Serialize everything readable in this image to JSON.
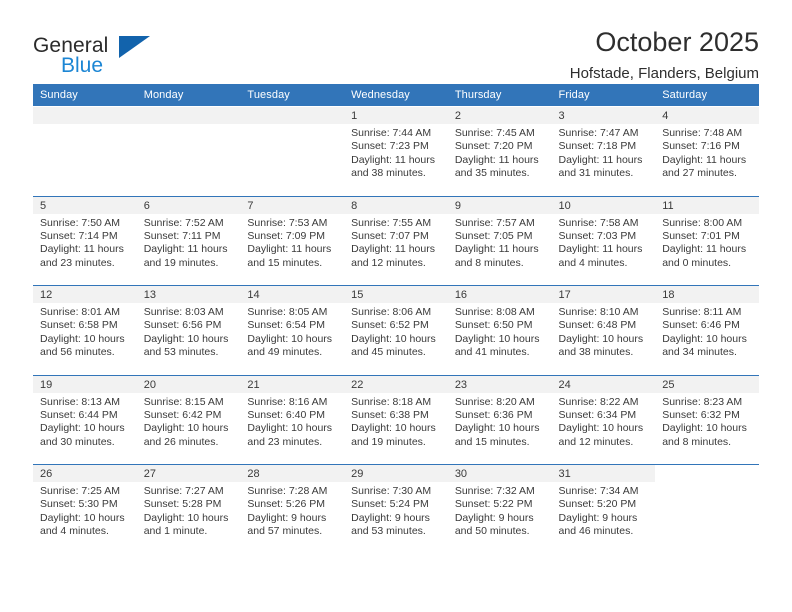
{
  "brand": {
    "line1": "General",
    "line2": "Blue",
    "logo_icon": "triangle-logo"
  },
  "header": {
    "title": "October 2025",
    "subtitle": "Hofstade, Flanders, Belgium"
  },
  "colors": {
    "header_blue": "#3275b9",
    "brand_blue": "#1c86d4",
    "logo_triangle": "#1263ac",
    "daynum_band": "#f2f2f2",
    "text": "#3a3a3a"
  },
  "weekday_headers": [
    "Sunday",
    "Monday",
    "Tuesday",
    "Wednesday",
    "Thursday",
    "Friday",
    "Saturday"
  ],
  "labels": {
    "sunrise_prefix": "Sunrise:",
    "sunset_prefix": "Sunset:",
    "daylight_prefix": "Daylight:"
  },
  "weeks": [
    [
      {
        "day": "",
        "empty": true
      },
      {
        "day": "",
        "empty": true
      },
      {
        "day": "",
        "empty": true
      },
      {
        "day": "1",
        "sunrise": "Sunrise: 7:44 AM",
        "sunset": "Sunset: 7:23 PM",
        "daylight": "Daylight: 11 hours and 38 minutes."
      },
      {
        "day": "2",
        "sunrise": "Sunrise: 7:45 AM",
        "sunset": "Sunset: 7:20 PM",
        "daylight": "Daylight: 11 hours and 35 minutes."
      },
      {
        "day": "3",
        "sunrise": "Sunrise: 7:47 AM",
        "sunset": "Sunset: 7:18 PM",
        "daylight": "Daylight: 11 hours and 31 minutes."
      },
      {
        "day": "4",
        "sunrise": "Sunrise: 7:48 AM",
        "sunset": "Sunset: 7:16 PM",
        "daylight": "Daylight: 11 hours and 27 minutes."
      }
    ],
    [
      {
        "day": "5",
        "sunrise": "Sunrise: 7:50 AM",
        "sunset": "Sunset: 7:14 PM",
        "daylight": "Daylight: 11 hours and 23 minutes."
      },
      {
        "day": "6",
        "sunrise": "Sunrise: 7:52 AM",
        "sunset": "Sunset: 7:11 PM",
        "daylight": "Daylight: 11 hours and 19 minutes."
      },
      {
        "day": "7",
        "sunrise": "Sunrise: 7:53 AM",
        "sunset": "Sunset: 7:09 PM",
        "daylight": "Daylight: 11 hours and 15 minutes."
      },
      {
        "day": "8",
        "sunrise": "Sunrise: 7:55 AM",
        "sunset": "Sunset: 7:07 PM",
        "daylight": "Daylight: 11 hours and 12 minutes."
      },
      {
        "day": "9",
        "sunrise": "Sunrise: 7:57 AM",
        "sunset": "Sunset: 7:05 PM",
        "daylight": "Daylight: 11 hours and 8 minutes."
      },
      {
        "day": "10",
        "sunrise": "Sunrise: 7:58 AM",
        "sunset": "Sunset: 7:03 PM",
        "daylight": "Daylight: 11 hours and 4 minutes."
      },
      {
        "day": "11",
        "sunrise": "Sunrise: 8:00 AM",
        "sunset": "Sunset: 7:01 PM",
        "daylight": "Daylight: 11 hours and 0 minutes."
      }
    ],
    [
      {
        "day": "12",
        "sunrise": "Sunrise: 8:01 AM",
        "sunset": "Sunset: 6:58 PM",
        "daylight": "Daylight: 10 hours and 56 minutes."
      },
      {
        "day": "13",
        "sunrise": "Sunrise: 8:03 AM",
        "sunset": "Sunset: 6:56 PM",
        "daylight": "Daylight: 10 hours and 53 minutes."
      },
      {
        "day": "14",
        "sunrise": "Sunrise: 8:05 AM",
        "sunset": "Sunset: 6:54 PM",
        "daylight": "Daylight: 10 hours and 49 minutes."
      },
      {
        "day": "15",
        "sunrise": "Sunrise: 8:06 AM",
        "sunset": "Sunset: 6:52 PM",
        "daylight": "Daylight: 10 hours and 45 minutes."
      },
      {
        "day": "16",
        "sunrise": "Sunrise: 8:08 AM",
        "sunset": "Sunset: 6:50 PM",
        "daylight": "Daylight: 10 hours and 41 minutes."
      },
      {
        "day": "17",
        "sunrise": "Sunrise: 8:10 AM",
        "sunset": "Sunset: 6:48 PM",
        "daylight": "Daylight: 10 hours and 38 minutes."
      },
      {
        "day": "18",
        "sunrise": "Sunrise: 8:11 AM",
        "sunset": "Sunset: 6:46 PM",
        "daylight": "Daylight: 10 hours and 34 minutes."
      }
    ],
    [
      {
        "day": "19",
        "sunrise": "Sunrise: 8:13 AM",
        "sunset": "Sunset: 6:44 PM",
        "daylight": "Daylight: 10 hours and 30 minutes."
      },
      {
        "day": "20",
        "sunrise": "Sunrise: 8:15 AM",
        "sunset": "Sunset: 6:42 PM",
        "daylight": "Daylight: 10 hours and 26 minutes."
      },
      {
        "day": "21",
        "sunrise": "Sunrise: 8:16 AM",
        "sunset": "Sunset: 6:40 PM",
        "daylight": "Daylight: 10 hours and 23 minutes."
      },
      {
        "day": "22",
        "sunrise": "Sunrise: 8:18 AM",
        "sunset": "Sunset: 6:38 PM",
        "daylight": "Daylight: 10 hours and 19 minutes."
      },
      {
        "day": "23",
        "sunrise": "Sunrise: 8:20 AM",
        "sunset": "Sunset: 6:36 PM",
        "daylight": "Daylight: 10 hours and 15 minutes."
      },
      {
        "day": "24",
        "sunrise": "Sunrise: 8:22 AM",
        "sunset": "Sunset: 6:34 PM",
        "daylight": "Daylight: 10 hours and 12 minutes."
      },
      {
        "day": "25",
        "sunrise": "Sunrise: 8:23 AM",
        "sunset": "Sunset: 6:32 PM",
        "daylight": "Daylight: 10 hours and 8 minutes."
      }
    ],
    [
      {
        "day": "26",
        "sunrise": "Sunrise: 7:25 AM",
        "sunset": "Sunset: 5:30 PM",
        "daylight": "Daylight: 10 hours and 4 minutes."
      },
      {
        "day": "27",
        "sunrise": "Sunrise: 7:27 AM",
        "sunset": "Sunset: 5:28 PM",
        "daylight": "Daylight: 10 hours and 1 minute."
      },
      {
        "day": "28",
        "sunrise": "Sunrise: 7:28 AM",
        "sunset": "Sunset: 5:26 PM",
        "daylight": "Daylight: 9 hours and 57 minutes."
      },
      {
        "day": "29",
        "sunrise": "Sunrise: 7:30 AM",
        "sunset": "Sunset: 5:24 PM",
        "daylight": "Daylight: 9 hours and 53 minutes."
      },
      {
        "day": "30",
        "sunrise": "Sunrise: 7:32 AM",
        "sunset": "Sunset: 5:22 PM",
        "daylight": "Daylight: 9 hours and 50 minutes."
      },
      {
        "day": "31",
        "sunrise": "Sunrise: 7:34 AM",
        "sunset": "Sunset: 5:20 PM",
        "daylight": "Daylight: 9 hours and 46 minutes."
      },
      {
        "day": "",
        "empty": true,
        "blank": true
      }
    ]
  ]
}
